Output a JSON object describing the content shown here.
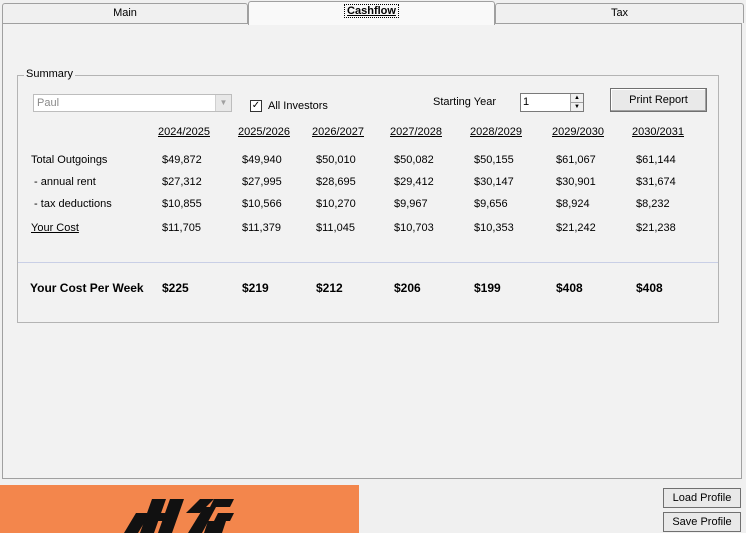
{
  "tabs": [
    {
      "label": "Main"
    },
    {
      "label": "Cashflow"
    },
    {
      "label": "Tax"
    }
  ],
  "summary": {
    "title": "Summary",
    "investor_select": {
      "value": "Paul"
    },
    "all_investors": {
      "label": "All Investors",
      "checked": true
    },
    "starting_year": {
      "label": "Starting Year",
      "value": "1"
    },
    "print_button": "Print Report",
    "years": [
      "2024/2025",
      "2025/2026",
      "2026/2027",
      "2027/2028",
      "2028/2029",
      "2029/2030",
      "2030/2031"
    ],
    "rows": [
      {
        "label": "Total Outgoings",
        "values": [
          "$49,872",
          "$49,940",
          "$50,010",
          "$50,082",
          "$50,155",
          "$61,067",
          "$61,144"
        ]
      },
      {
        "label": " - annual rent",
        "values": [
          "$27,312",
          "$27,995",
          "$28,695",
          "$29,412",
          "$30,147",
          "$30,901",
          "$31,674"
        ]
      },
      {
        "label": " - tax deductions",
        "values": [
          "$10,855",
          "$10,566",
          "$10,270",
          "$9,967",
          "$9,656",
          "$8,924",
          "$8,232"
        ]
      },
      {
        "label": "Your Cost",
        "values": [
          "$11,705",
          "$11,379",
          "$11,045",
          "$10,703",
          "$10,353",
          "$21,242",
          "$21,238"
        ]
      }
    ],
    "weekly": {
      "label": "Your Cost Per Week",
      "values": [
        "$225",
        "$219",
        "$212",
        "$206",
        "$199",
        "$408",
        "$408"
      ]
    }
  },
  "footer": {
    "load_profile": "Load Profile",
    "save_profile": "Save Profile"
  },
  "colors": {
    "logo_background": "#f3864c",
    "logo_mark": "#111111"
  }
}
